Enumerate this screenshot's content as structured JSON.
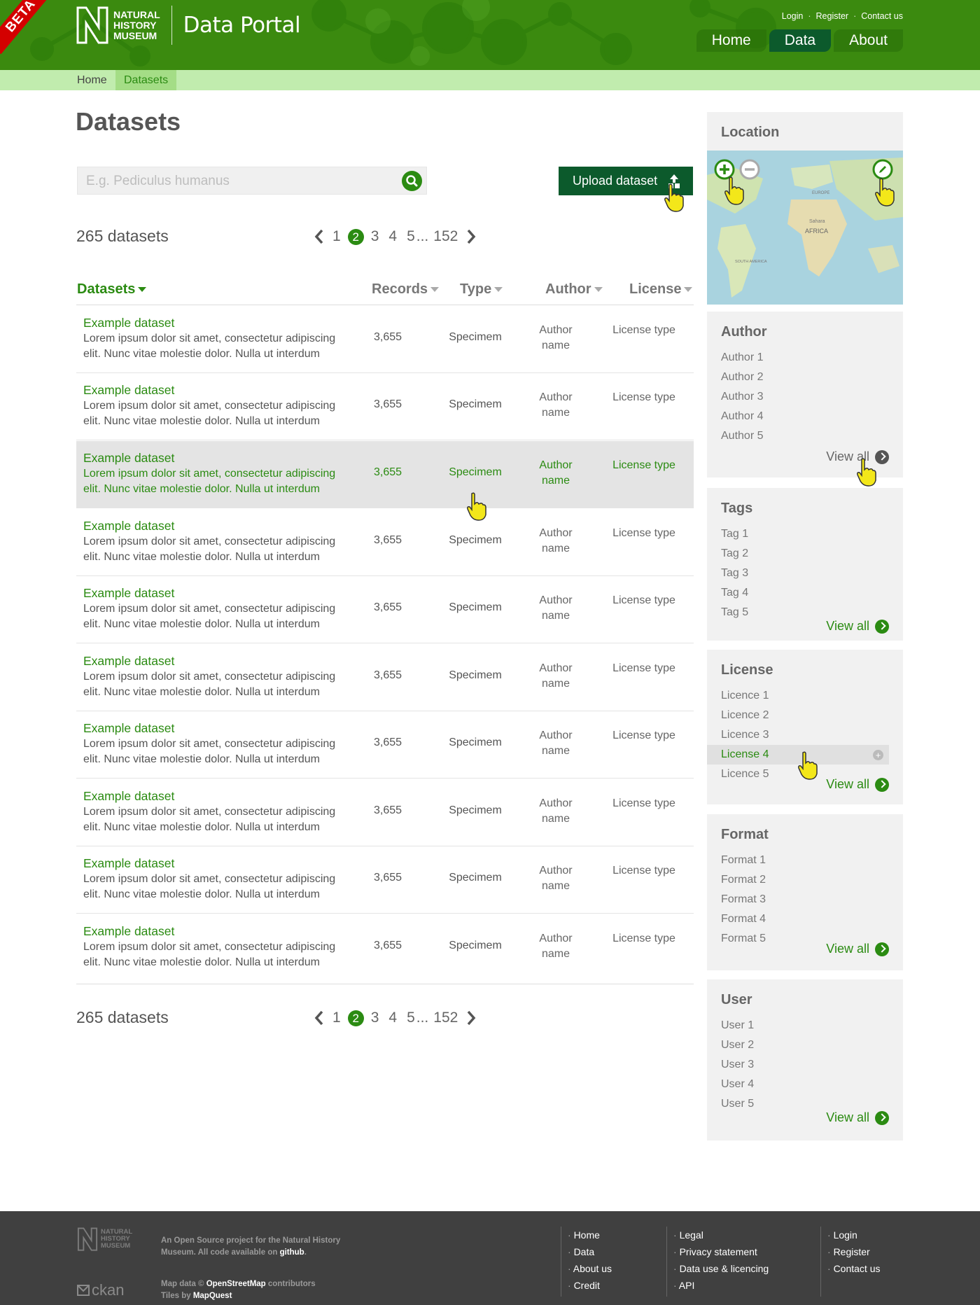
{
  "header": {
    "beta": "BETA",
    "logo_lines": [
      "NATURAL",
      "HISTORY",
      "MUSEUM"
    ],
    "portal_title": "Data Portal",
    "top_links": [
      "Login",
      "Register",
      "Contact us"
    ],
    "nav": [
      {
        "label": "Home",
        "active": false
      },
      {
        "label": "Data",
        "active": true
      },
      {
        "label": "About",
        "active": false
      }
    ]
  },
  "breadcrumb": [
    "Home",
    "Datasets"
  ],
  "page_title": "Datasets",
  "search": {
    "placeholder": "E.g. Pediculus humanus"
  },
  "upload_label": "Upload dataset",
  "dataset_count": "265 datasets",
  "pagination": {
    "pages": [
      "1",
      "2",
      "3",
      "4",
      "5",
      "...",
      "152"
    ],
    "current": "2"
  },
  "table": {
    "columns": [
      "Datasets",
      "Records",
      "Type",
      "Author",
      "License"
    ],
    "rows": [
      {
        "name": "Example dataset",
        "desc": "Lorem ipsum dolor sit amet, consectetur adipiscing elit. Nunc vitae molestie dolor. Nulla ut interdum",
        "records": "3,655",
        "type": "Specimem",
        "author": "Author name",
        "license": "License type"
      },
      {
        "name": "Example dataset",
        "desc": "Lorem ipsum dolor sit amet, consectetur adipiscing elit. Nunc vitae molestie dolor. Nulla ut interdum",
        "records": "3,655",
        "type": "Specimem",
        "author": "Author name",
        "license": "License type"
      },
      {
        "name": "Example dataset",
        "desc": "Lorem ipsum dolor sit amet, consectetur adipiscing elit. Nunc vitae molestie dolor. Nulla ut interdum",
        "records": "3,655",
        "type": "Specimem",
        "author": "Author name",
        "license": "License type",
        "highlighted": true
      },
      {
        "name": "Example dataset",
        "desc": "Lorem ipsum dolor sit amet, consectetur adipiscing elit. Nunc vitae molestie dolor. Nulla ut interdum",
        "records": "3,655",
        "type": "Specimem",
        "author": "Author name",
        "license": "License type"
      },
      {
        "name": "Example dataset",
        "desc": "Lorem ipsum dolor sit amet, consectetur adipiscing elit. Nunc vitae molestie dolor. Nulla ut interdum",
        "records": "3,655",
        "type": "Specimem",
        "author": "Author name",
        "license": "License type"
      },
      {
        "name": "Example dataset",
        "desc": "Lorem ipsum dolor sit amet, consectetur adipiscing elit. Nunc vitae molestie dolor. Nulla ut interdum",
        "records": "3,655",
        "type": "Specimem",
        "author": "Author name",
        "license": "License type"
      },
      {
        "name": "Example dataset",
        "desc": "Lorem ipsum dolor sit amet, consectetur adipiscing elit. Nunc vitae molestie dolor. Nulla ut interdum",
        "records": "3,655",
        "type": "Specimem",
        "author": "Author name",
        "license": "License type"
      },
      {
        "name": "Example dataset",
        "desc": "Lorem ipsum dolor sit amet, consectetur adipiscing elit. Nunc vitae molestie dolor. Nulla ut interdum",
        "records": "3,655",
        "type": "Specimem",
        "author": "Author name",
        "license": "License type"
      },
      {
        "name": "Example dataset",
        "desc": "Lorem ipsum dolor sit amet, consectetur adipiscing elit. Nunc vitae molestie dolor. Nulla ut interdum",
        "records": "3,655",
        "type": "Specimem",
        "author": "Author name",
        "license": "License type"
      },
      {
        "name": "Example dataset",
        "desc": "Lorem ipsum dolor sit amet, consectetur adipiscing elit. Nunc vitae molestie dolor. Nulla ut interdum",
        "records": "3,655",
        "type": "Specimem",
        "author": "Author name",
        "license": "License type"
      }
    ]
  },
  "sidebar": {
    "location": {
      "title": "Location",
      "map_labels": [
        "Sahara",
        "AFRICA",
        "EUROPE",
        "SOUTH AMERICA"
      ]
    },
    "facets": [
      {
        "title": "Author",
        "items": [
          "Author 1",
          "Author 2",
          "Author 3",
          "Author 4",
          "Author 5"
        ],
        "view_all": "View all"
      },
      {
        "title": "Tags",
        "items": [
          "Tag 1",
          "Tag 2",
          "Tag 3",
          "Tag 4",
          "Tag 5"
        ],
        "view_all": "View all"
      },
      {
        "title": "License",
        "items": [
          "Licence 1",
          "Licence 2",
          "Licence 3",
          "License 4",
          "Licence 5"
        ],
        "view_all": "View all"
      },
      {
        "title": "Format",
        "items": [
          "Format 1",
          "Format 2",
          "Format 3",
          "Format 4",
          "Format 5"
        ],
        "view_all": "View all"
      },
      {
        "title": "User",
        "items": [
          "User 1",
          "User 2",
          "User 3",
          "User 4",
          "User 5"
        ],
        "view_all": "View all"
      }
    ]
  },
  "footer": {
    "logo_lines": [
      "NATURAL",
      "HISTORY",
      "MUSEUM"
    ],
    "about_text": "An Open Source project for the Natural History Museum.  All code available on ",
    "about_link": "github",
    "map_text_1": "Map data © ",
    "map_link_1": "OpenStreetMap",
    "map_text_2": " contributors",
    "map_text_3": "Tiles by ",
    "map_link_2": "MapQuest",
    "ckan": "ckan",
    "col1": [
      "Home",
      "Data",
      "About us",
      "Credit"
    ],
    "col2": [
      "Legal",
      "Privacy statement",
      "Data use & licencing",
      "API"
    ],
    "col3": [
      "Login",
      "Register",
      "Contact us"
    ]
  },
  "colors": {
    "brand_green": "#3b8a0f",
    "accent_green": "#2b8b12",
    "dark_green": "#0c5a2c",
    "breadcrumb_bg": "#c1ecae",
    "footer_bg": "#404040"
  }
}
